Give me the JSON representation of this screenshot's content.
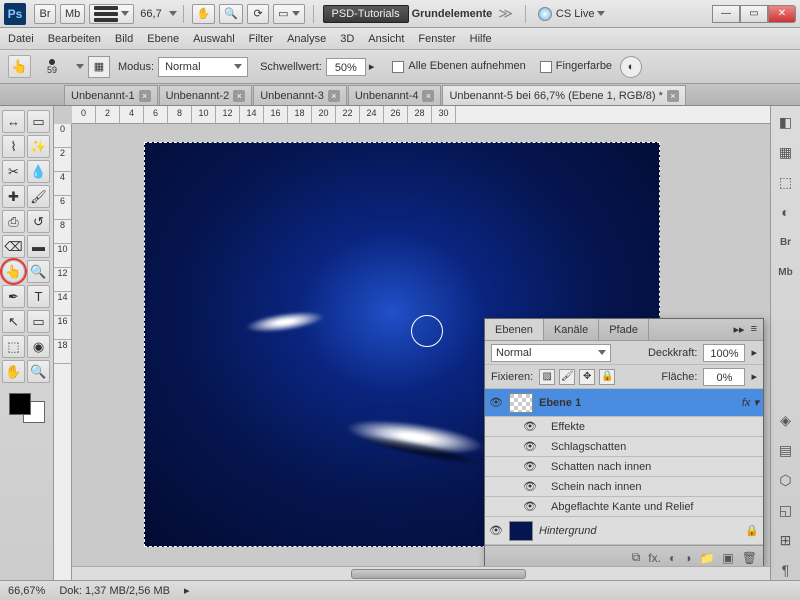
{
  "titlebar": {
    "br": "Br",
    "mb": "Mb",
    "zoom": "66,7",
    "psd_tut": "PSD-Tutorials",
    "grund": "Grundelemente",
    "cslive": "CS Live"
  },
  "menu": [
    "Datei",
    "Bearbeiten",
    "Bild",
    "Ebene",
    "Auswahl",
    "Filter",
    "Analyse",
    "3D",
    "Ansicht",
    "Fenster",
    "Hilfe"
  ],
  "options": {
    "brush_size": "59",
    "modus_label": "Modus:",
    "modus_value": "Normal",
    "schw_label": "Schwellwert:",
    "schw_value": "50%",
    "chk1": "Alle Ebenen aufnehmen",
    "chk2": "Fingerfarbe"
  },
  "tabs": {
    "t1": "Unbenannt-1",
    "t2": "Unbenannt-2",
    "t3": "Unbenannt-3",
    "t4": "Unbenannt-4",
    "t5": "Unbenannt-5 bei 66,7% (Ebene 1, RGB/8) *"
  },
  "ruler_h": [
    "0",
    "2",
    "4",
    "6",
    "8",
    "10",
    "12",
    "14",
    "16",
    "18",
    "20",
    "22",
    "24",
    "26",
    "28",
    "30"
  ],
  "ruler_v": [
    "0",
    "2",
    "4",
    "6",
    "8",
    "10",
    "12",
    "14",
    "16",
    "18"
  ],
  "layers": {
    "tab_layers": "Ebenen",
    "tab_channels": "Kanäle",
    "tab_paths": "Pfade",
    "blend": "Normal",
    "opac_label": "Deckkraft:",
    "opac": "100%",
    "fix_label": "Fixieren:",
    "fill_label": "Fläche:",
    "fill": "0%",
    "l1": "Ebene 1",
    "fx": "Effekte",
    "e1": "Schlagschatten",
    "e2": "Schatten nach innen",
    "e3": "Schein nach innen",
    "e4": "Abgeflachte Kante und Relief",
    "bgname": "Hintergrund"
  },
  "status": {
    "zoom": "66,67%",
    "doc": "Dok: 1,37 MB/2,56 MB"
  }
}
